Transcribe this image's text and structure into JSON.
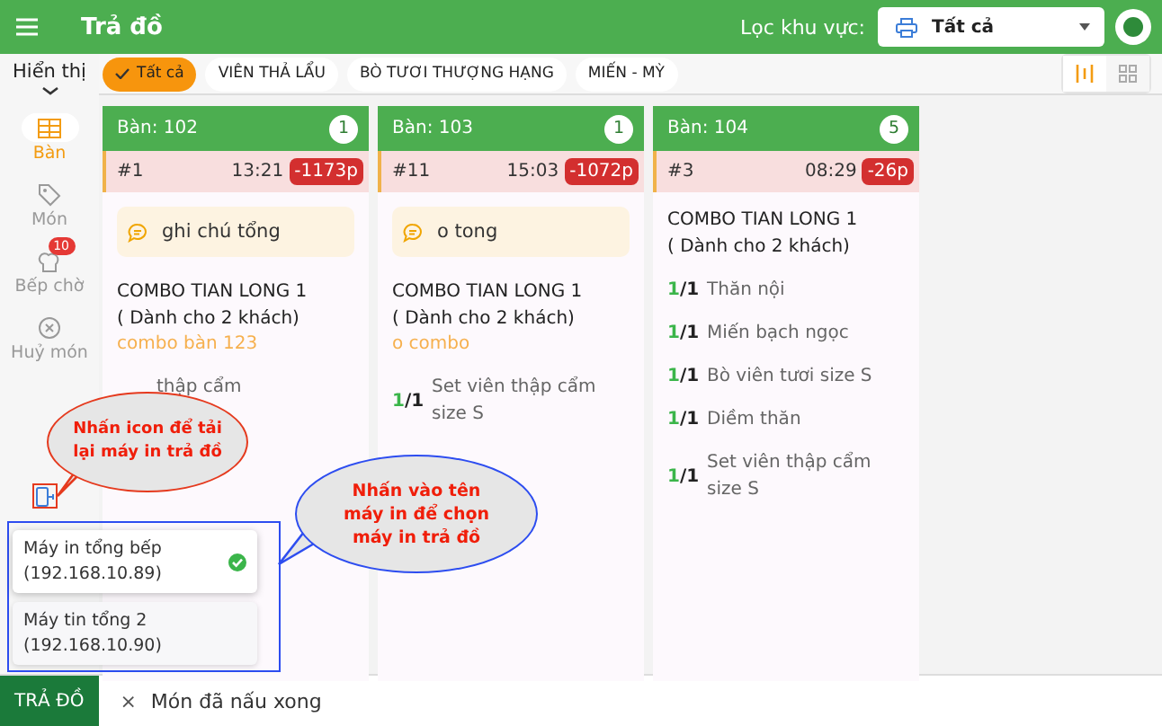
{
  "header": {
    "title": "Trả đồ",
    "filter_label": "Lọc khu vực:",
    "filter_value": "Tất cả"
  },
  "display_label": "Hiển thị",
  "sidebar": [
    {
      "label": "Bàn",
      "selected": true
    },
    {
      "label": "Món",
      "selected": false
    },
    {
      "label": "Bếp chờ",
      "selected": false,
      "badge": "10"
    },
    {
      "label": "Huỷ món",
      "selected": false
    }
  ],
  "chips": [
    {
      "label": "Tất cả",
      "selected": true
    },
    {
      "label": "VIÊN THẢ LẨU",
      "selected": false
    },
    {
      "label": "BÒ TƯƠI THƯỢNG HẠNG",
      "selected": false
    },
    {
      "label": "MIẾN - MỲ",
      "selected": false
    }
  ],
  "views": [
    {
      "kind": "columns",
      "selected": true
    },
    {
      "kind": "grid",
      "selected": false
    }
  ],
  "cards": [
    {
      "table": "Bàn: 102",
      "count": "1",
      "order": "#1",
      "time": "13:21",
      "late": "-1173p",
      "note": "ghi chú tổng",
      "combo": "COMBO TIAN LONG 1\n( Dành cho 2 khách)",
      "combo_note": "combo bàn 123",
      "items": [
        {
          "name": "thập cẩm"
        }
      ]
    },
    {
      "table": "Bàn: 103",
      "count": "1",
      "order": "#11",
      "time": "15:03",
      "late": "-1072p",
      "note": "o tong",
      "combo": "COMBO TIAN LONG 1\n( Dành cho 2 khách)",
      "combo_note": "o combo",
      "items": [
        {
          "done": "1",
          "total": "/1",
          "name": "Set viên thập cẩm size S"
        }
      ]
    },
    {
      "table": "Bàn: 104",
      "count": "5",
      "order": "#3",
      "time": "08:29",
      "late": "-26p",
      "combo": "COMBO TIAN LONG 1\n( Dành cho 2 khách)",
      "items": [
        {
          "done": "1",
          "total": "/1",
          "name": "Thăn nội"
        },
        {
          "done": "1",
          "total": "/1",
          "name": "Miến bạch ngọc"
        },
        {
          "done": "1",
          "total": "/1",
          "name": "Bò viên tươi size S"
        },
        {
          "done": "1",
          "total": "/1",
          "name": "Diềm thăn"
        },
        {
          "done": "1",
          "total": "/1",
          "name": "Set viên thập cẩm size S"
        }
      ]
    }
  ],
  "printers": [
    {
      "name": "Máy in tổng bếp",
      "ip": "(192.168.10.89)",
      "selected": true
    },
    {
      "name": "Máy tin tổng 2",
      "ip": "(192.168.10.90)",
      "selected": false
    }
  ],
  "callouts": [
    {
      "kind": "red",
      "text": "Nhấn icon để tải lại máy in trả đồ"
    },
    {
      "kind": "blue",
      "text": "Nhấn vào tên máy in để chọn máy in trả đồ"
    }
  ],
  "bottom": {
    "button": "TRẢ ĐỒ",
    "toggle": "×",
    "label": "Món đã nấu xong"
  }
}
